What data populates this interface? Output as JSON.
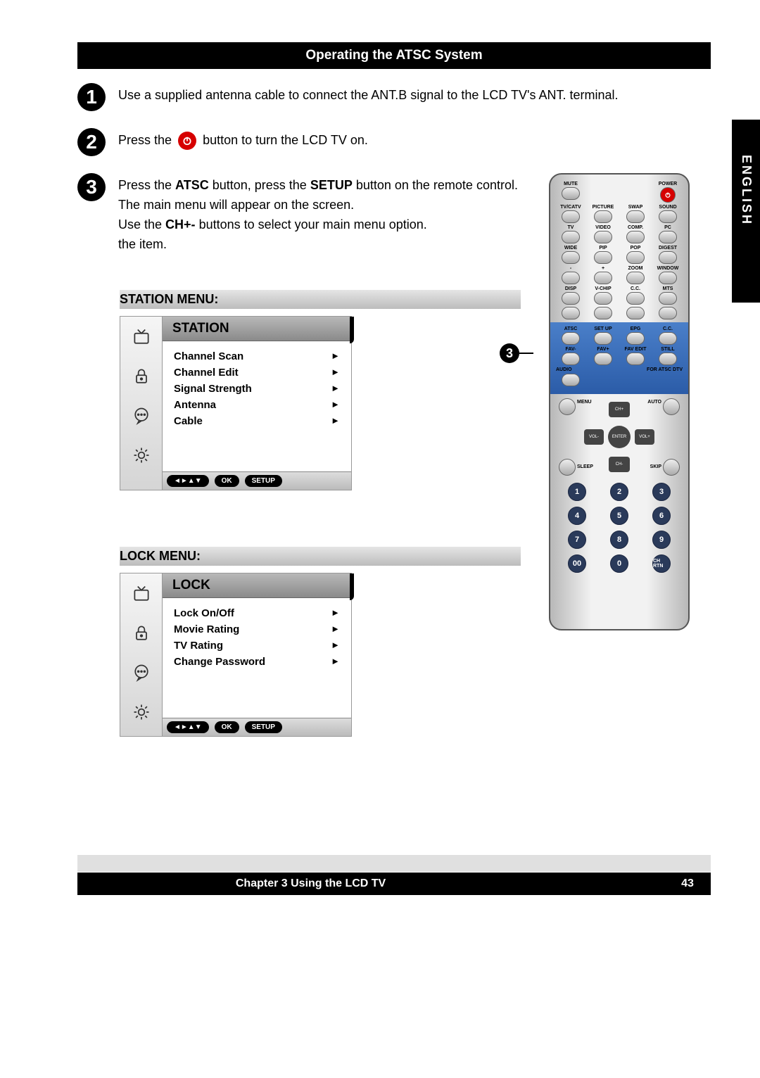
{
  "header": {
    "title": "Operating the ATSC System"
  },
  "side_tab": "ENGLISH",
  "steps": {
    "s1": "Use a supplied antenna cable to connect the ANT.B signal to the LCD TV's ANT. terminal.",
    "s2a": "Press the",
    "s2b": "button to turn the LCD TV on.",
    "s3a": "Press the ",
    "s3b_bold": "ATSC",
    "s3c": " button, press the ",
    "s3d_bold": "SETUP",
    "s3e": " button on the remote control. The main menu will appear on the screen.",
    "s3f": "Use the ",
    "s3g_bold": "CH+-",
    "s3h": " buttons to select your main menu option.",
    "s3i": "the item."
  },
  "menus": {
    "station": {
      "label": "STATION MENU:",
      "title": "STATION",
      "items": [
        "Channel Scan",
        "Channel Edit",
        "Signal Strength",
        "Antenna",
        "Cable"
      ],
      "footer": {
        "nav": "◄►▲▼",
        "ok": "OK",
        "setup": "SETUP"
      }
    },
    "lock": {
      "label": "LOCK MENU:",
      "title": "LOCK",
      "items": [
        "Lock On/Off",
        "Movie Rating",
        "TV Rating",
        "Change Password"
      ],
      "footer": {
        "nav": "◄►▲▼",
        "ok": "OK",
        "setup": "SETUP"
      }
    }
  },
  "remote": {
    "row1": {
      "mute": "MUTE",
      "power": "POWER"
    },
    "row2": [
      "TV/CATV",
      "PICTURE",
      "SWAP",
      "SOUND"
    ],
    "row3": [
      "TV",
      "VIDEO",
      "COMP.",
      "PC"
    ],
    "row4": [
      "WIDE",
      "PIP",
      "POP",
      "DIGEST"
    ],
    "row5": [
      "-",
      "+",
      "ZOOM",
      "WINDOW"
    ],
    "row6": [
      "DISP",
      "V-CHIP",
      "C.C.",
      "MTS"
    ],
    "atsc_row1": [
      "ATSC",
      "SET UP",
      "EPG",
      "C.C."
    ],
    "atsc_row2": [
      "FAV-",
      "FAV+",
      "FAV EDIT",
      "STILL"
    ],
    "atsc_footer": {
      "left": "AUDIO",
      "right": "FOR ATSC DTV"
    },
    "nav": {
      "menu": "MENU",
      "auto": "AUTO",
      "sleep": "SLEEP",
      "skip": "SKIP",
      "up": "CH+",
      "down": "CH-",
      "left": "VOL-",
      "right": "VOL+",
      "center": "ENTER"
    },
    "numpad": [
      "1",
      "2",
      "3",
      "4",
      "5",
      "6",
      "7",
      "8",
      "9",
      "00",
      "0",
      "CH RTN"
    ]
  },
  "callout": "3",
  "footer": {
    "chapter": "Chapter 3 Using the LCD TV",
    "page": "43"
  }
}
